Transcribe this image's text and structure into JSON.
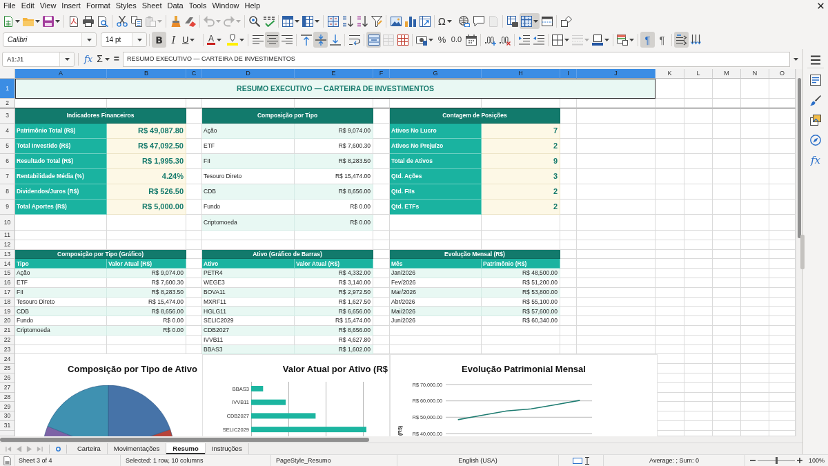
{
  "menu_bar": [
    "File",
    "Edit",
    "View",
    "Insert",
    "Format",
    "Styles",
    "Sheet",
    "Data",
    "Tools",
    "Window",
    "Help"
  ],
  "toolbars": [
    {
      "buttons": [
        {
          "pressed": false,
          "disabled": false
        },
        {
          "pressed": false,
          "disabled": false
        },
        {
          "pressed": false,
          "disabled": false
        },
        {
          "pressed": false,
          "disabled": false
        },
        {
          "pressed": false,
          "disabled": false
        },
        {
          "pressed": false,
          "disabled": false
        },
        {
          "pressed": false,
          "disabled": false
        },
        {
          "pressed": false,
          "disabled": false
        },
        {
          "pressed": false,
          "disabled": true
        },
        {
          "pressed": false,
          "disabled": false
        },
        {
          "pressed": false,
          "disabled": false
        },
        {
          "pressed": false,
          "disabled": true
        },
        {
          "pressed": false,
          "disabled": true
        },
        {
          "pressed": false,
          "disabled": false
        },
        {
          "pressed": false,
          "disabled": false
        },
        {
          "pressed": false,
          "disabled": false
        },
        {
          "pressed": false,
          "disabled": false
        },
        {
          "pressed": false,
          "disabled": false
        },
        {
          "pressed": false,
          "disabled": false
        },
        {
          "pressed": false,
          "disabled": false
        },
        {
          "pressed": false,
          "disabled": false
        },
        {
          "pressed": false,
          "disabled": false
        },
        {
          "pressed": false,
          "disabled": false
        },
        {
          "pressed": false,
          "disabled": false
        },
        {
          "label": "Ω",
          "pressed": false,
          "disabled": false
        },
        {
          "pressed": false,
          "disabled": false
        },
        {
          "pressed": false,
          "disabled": false
        },
        {
          "pressed": false,
          "disabled": true
        },
        {
          "pressed": false,
          "disabled": false
        },
        {
          "pressed": true,
          "disabled": false
        },
        {
          "pressed": false,
          "disabled": false
        },
        {
          "pressed": false,
          "disabled": false
        }
      ]
    },
    {
      "font_name": "Calibri",
      "font_size": "14 pt",
      "buttons": [
        {
          "label": "B",
          "pressed": true,
          "disabled": false
        },
        {
          "label": "I",
          "pressed": false,
          "disabled": false
        },
        {
          "label": "U",
          "pressed": false,
          "disabled": false
        },
        {
          "label": "A",
          "pressed": false,
          "disabled": false
        },
        {
          "pressed": false,
          "disabled": false
        },
        {
          "pressed": false,
          "disabled": false
        },
        {
          "pressed": true,
          "disabled": false
        },
        {
          "pressed": false,
          "disabled": false
        },
        {
          "pressed": false,
          "disabled": false
        },
        {
          "pressed": true,
          "disabled": false
        },
        {
          "pressed": false,
          "disabled": false
        },
        {
          "pressed": false,
          "disabled": false
        },
        {
          "pressed": true,
          "disabled": false
        },
        {
          "pressed": false,
          "disabled": true
        },
        {
          "pressed": false,
          "disabled": false
        },
        {
          "pressed": false,
          "disabled": false
        },
        {
          "label": "%",
          "pressed": false,
          "disabled": false
        },
        {
          "label": "0.0",
          "pressed": false,
          "disabled": false
        },
        {
          "pressed": false,
          "disabled": false
        },
        {
          "pressed": false,
          "disabled": false
        },
        {
          "pressed": false,
          "disabled": false
        },
        {
          "pressed": false,
          "disabled": false
        },
        {
          "pressed": false,
          "disabled": false
        },
        {
          "pressed": false,
          "disabled": false
        },
        {
          "pressed": false,
          "disabled": true
        },
        {
          "pressed": false,
          "disabled": false
        },
        {
          "pressed": false,
          "disabled": false
        },
        {
          "label": "¶",
          "pressed": true,
          "disabled": false
        },
        {
          "label": "¶",
          "pressed": false,
          "disabled": false
        },
        {
          "pressed": true,
          "disabled": false
        },
        {
          "pressed": false,
          "disabled": false
        }
      ]
    }
  ],
  "formula_bar": {
    "name_box": "A1:J1",
    "function_wizard": "fx",
    "sum": "Σ",
    "equals": "=",
    "content": "RESUMO EXECUTIVO — CARTEIRA DE INVESTIMENTOS"
  },
  "sidebar": {
    "functions": "fx"
  },
  "sheet": {
    "columns": [
      {
        "label": "A",
        "selected": true
      },
      {
        "label": "B",
        "selected": true
      },
      {
        "label": "C",
        "selected": true
      },
      {
        "label": "D",
        "selected": true
      },
      {
        "label": "E",
        "selected": true
      },
      {
        "label": "F",
        "selected": true
      },
      {
        "label": "G",
        "selected": true
      },
      {
        "label": "H",
        "selected": true
      },
      {
        "label": "I",
        "selected": true
      },
      {
        "label": "J",
        "selected": true
      },
      {
        "label": "K",
        "selected": false
      },
      {
        "label": "L",
        "selected": false
      },
      {
        "label": "M",
        "selected": false
      },
      {
        "label": "N",
        "selected": false
      },
      {
        "label": "O",
        "selected": false
      }
    ],
    "rows": [
      {
        "label": "1",
        "selected": true
      },
      {
        "label": "2",
        "selected": false
      },
      {
        "label": "3",
        "selected": false
      },
      {
        "label": "4",
        "selected": false
      },
      {
        "label": "5",
        "selected": false
      },
      {
        "label": "6",
        "selected": false
      },
      {
        "label": "7",
        "selected": false
      },
      {
        "label": "8",
        "selected": false
      },
      {
        "label": "9",
        "selected": false
      },
      {
        "label": "10",
        "selected": false
      },
      {
        "label": "11",
        "selected": false
      },
      {
        "label": "12",
        "selected": false
      },
      {
        "label": "13",
        "selected": false
      },
      {
        "label": "14",
        "selected": false
      },
      {
        "label": "15",
        "selected": false
      },
      {
        "label": "16",
        "selected": false
      },
      {
        "label": "17",
        "selected": false
      },
      {
        "label": "18",
        "selected": false
      },
      {
        "label": "19",
        "selected": false
      },
      {
        "label": "20",
        "selected": false
      },
      {
        "label": "21",
        "selected": false
      },
      {
        "label": "22",
        "selected": false
      },
      {
        "label": "23",
        "selected": false
      },
      {
        "label": "24",
        "selected": false
      },
      {
        "label": "25",
        "selected": false
      },
      {
        "label": "26",
        "selected": false
      },
      {
        "label": "27",
        "selected": false
      },
      {
        "label": "28",
        "selected": false
      },
      {
        "label": "29",
        "selected": false
      },
      {
        "label": "30",
        "selected": false
      },
      {
        "label": "31",
        "selected": false
      }
    ],
    "title": "RESUMO EXECUTIVO — CARTEIRA DE INVESTIMENTOS",
    "summary_tables": [
      {
        "kind": "highlight",
        "title": "Indicadores Financeiros",
        "rows": [
          {
            "label": "Patrimônio Total (R$)",
            "value": "R$ 49,087.80"
          },
          {
            "label": "Total Investido (R$)",
            "value": "R$ 47,092.50"
          },
          {
            "label": "Resultado Total (R$)",
            "value": "R$ 1,995.30"
          },
          {
            "label": "Rentabilidade Média (%)",
            "value": "4.24%"
          },
          {
            "label": "Dividendos/Juros (R$)",
            "value": "R$ 526.50"
          },
          {
            "label": "Total Aportes (R$)",
            "value": "R$ 5,000.00"
          }
        ]
      },
      {
        "kind": "striped",
        "title": "Composição por Tipo",
        "rows": [
          {
            "label": "Ação",
            "value": "R$ 9,074.00"
          },
          {
            "label": "ETF",
            "value": "R$ 7,600.30"
          },
          {
            "label": "FII",
            "value": "R$ 8,283.50"
          },
          {
            "label": "Tesouro Direto",
            "value": "R$ 15,474.00"
          },
          {
            "label": "CDB",
            "value": "R$ 8,656.00"
          },
          {
            "label": "Fundo",
            "value": "R$ 0.00"
          },
          {
            "label": "Criptomoeda",
            "value": "R$ 0.00"
          }
        ]
      },
      {
        "kind": "highlight",
        "title": "Contagem de Posições",
        "rows": [
          {
            "label": "Ativos No Lucro",
            "value": "7"
          },
          {
            "label": "Ativos No Prejuízo",
            "value": "2"
          },
          {
            "label": "Total de Ativos",
            "value": "9"
          },
          {
            "label": "Qtd. Ações",
            "value": "3"
          },
          {
            "label": "Qtd. FIIs",
            "value": "2"
          },
          {
            "label": "Qtd. ETFs",
            "value": "2"
          }
        ]
      }
    ],
    "data_tables": [
      {
        "title": "Composição por Tipo (Gráfico)",
        "headers": [
          "Tipo",
          "Valor Atual (R$)"
        ],
        "rows": [
          {
            "label": "Ação",
            "value": "R$ 9,074.00"
          },
          {
            "label": "ETF",
            "value": "R$ 7,600.30"
          },
          {
            "label": "FII",
            "value": "R$ 8,283.50"
          },
          {
            "label": "Tesouro Direto",
            "value": "R$ 15,474.00"
          },
          {
            "label": "CDB",
            "value": "R$ 8,656.00"
          },
          {
            "label": "Fundo",
            "value": "R$ 0.00"
          },
          {
            "label": "Criptomoeda",
            "value": "R$ 0.00"
          }
        ]
      },
      {
        "title": "Ativo (Gráfico de Barras)",
        "headers": [
          "Ativo",
          "Valor Atual (R$)"
        ],
        "rows": [
          {
            "label": "PETR4",
            "value": "R$ 4,332.00"
          },
          {
            "label": "WEGE3",
            "value": "R$ 3,140.00"
          },
          {
            "label": "BOVA11",
            "value": "R$ 2,972.50"
          },
          {
            "label": "MXRF11",
            "value": "R$ 1,627.50"
          },
          {
            "label": "HGLG11",
            "value": "R$ 6,656.00"
          },
          {
            "label": "SELIC2029",
            "value": "R$ 15,474.00"
          },
          {
            "label": "CDB2027",
            "value": "R$ 8,656.00"
          },
          {
            "label": "IVVB11",
            "value": "R$ 4,627.80"
          },
          {
            "label": "BBAS3",
            "value": "R$ 1,602.00"
          }
        ]
      },
      {
        "title": "Evolução Mensal (R$)",
        "headers": [
          "Mês",
          "Patrimônio (R$)"
        ],
        "rows": [
          {
            "label": "Jan/2026",
            "value": "R$ 48,500.00"
          },
          {
            "label": "Fev/2026",
            "value": "R$ 51,200.00"
          },
          {
            "label": "Mar/2026",
            "value": "R$ 53,800.00"
          },
          {
            "label": "Abr/2026",
            "value": "R$ 55,100.00"
          },
          {
            "label": "Mai/2026",
            "value": "R$ 57,600.00"
          },
          {
            "label": "Jun/2026",
            "value": "R$ 60,340.00"
          }
        ]
      }
    ],
    "charts": [
      {
        "kind": "pie",
        "title": "Composição por Tipo de Ativo"
      },
      {
        "kind": "bar",
        "title": "Valor Atual por Ativo (R$",
        "categories": [
          "BBAS3",
          "IVVB11",
          "CDB2027",
          "SELIC2029"
        ]
      },
      {
        "kind": "line",
        "title": "Evolução Patrimonial Mensal",
        "y_axis_labels": [
          "R$ 70,000.00",
          "R$ 60,000.00",
          "R$ 50,000.00",
          "R$ 40,000.00"
        ],
        "y_axis_title": "(R$)"
      }
    ]
  },
  "sheet_navigation": [
    {
      "disabled": true
    },
    {
      "disabled": true
    },
    {
      "disabled": true
    },
    {
      "disabled": true
    }
  ],
  "sheet_tabs": [
    {
      "label": "Carteira",
      "selected": false
    },
    {
      "label": "Movimentações",
      "selected": false
    },
    {
      "label": "Resumo",
      "selected": true
    },
    {
      "label": "Instruções",
      "selected": false
    }
  ],
  "status_bar": {
    "sheet": "Sheet 3 of 4",
    "selection": "Selected: 1 row, 10 columns",
    "page_style": "PageStyle_Resumo",
    "language": "English (USA)",
    "aggregate": "Average: ; Sum: 0",
    "zoom": {
      "level": 0.5
    },
    "zoom_value": "100%"
  }
}
